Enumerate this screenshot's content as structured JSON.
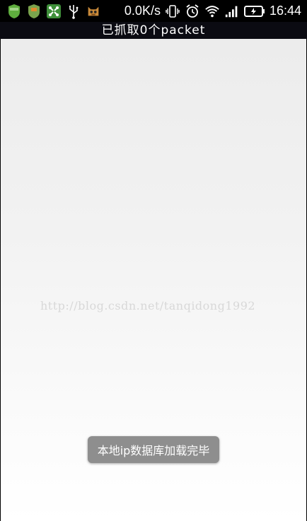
{
  "status_bar": {
    "left_icons": [
      "shield-green-icon",
      "shield-orange-icon",
      "apps-grid-icon",
      "usb-icon",
      "cat-app-icon"
    ],
    "speed": "0.0K/s",
    "time": "16:44",
    "right_icons": [
      "vibrate-icon",
      "alarm-icon",
      "wifi-icon",
      "signal-icon",
      "battery-charging-icon"
    ]
  },
  "title_bar": {
    "title": "已抓取0个packet"
  },
  "content": {
    "watermark": "http://blog.csdn.net/tanqidong1992"
  },
  "toast": {
    "message": "本地ip数据库加载完毕"
  }
}
